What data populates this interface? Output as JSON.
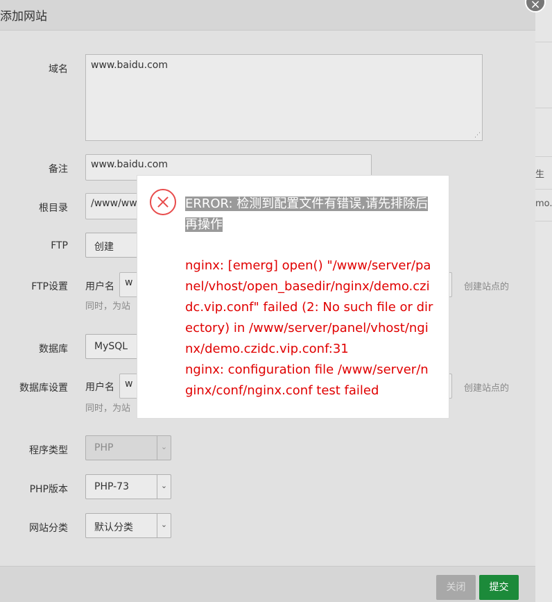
{
  "dialog": {
    "title": "添加网站",
    "close_icon": "close-icon"
  },
  "form": {
    "domain_label": "域名",
    "domain_value": "www.baidu.com",
    "remark_label": "备注",
    "remark_value": "www.baidu.com",
    "root_label": "根目录",
    "root_value": "/www/ww",
    "ftp_label": "FTP",
    "ftp_value": "创建",
    "ftp_settings_label": "FTP设置",
    "ftp_user_label": "用户名",
    "ftp_user_value": "w",
    "ftp_hint_1": "同时，为站",
    "ftp_hint_2": "创建站点的",
    "db_label": "数据库",
    "db_value": "MySQL",
    "db_settings_label": "数据库设置",
    "db_user_label": "用户名",
    "db_user_value": "w",
    "db_hint_1": "同时，为站",
    "db_hint_2": "创建站点的",
    "program_type_label": "程序类型",
    "program_type_value": "PHP",
    "php_version_label": "PHP版本",
    "php_version_value": "PHP-73",
    "category_label": "网站分类",
    "category_value": "默认分类"
  },
  "buttons": {
    "close": "关闭",
    "submit": "提交"
  },
  "error": {
    "header_prefix": "ERROR: ",
    "header_text": "检测到配置文件有错误,请先排除后再操作",
    "message_line1": "nginx: [emerg] open() \"/www/server/panel/vhost/open_basedir/nginx/demo.czidc.vip.conf\" failed (2: No such file or directory) in /www/server/panel/vhost/nginx/demo.czidc.vip.conf:31",
    "message_line2": "nginx: configuration file /www/server/nginx/conf/nginx.conf test failed"
  },
  "background": {
    "text_1": "生",
    "text_2": "mo."
  }
}
